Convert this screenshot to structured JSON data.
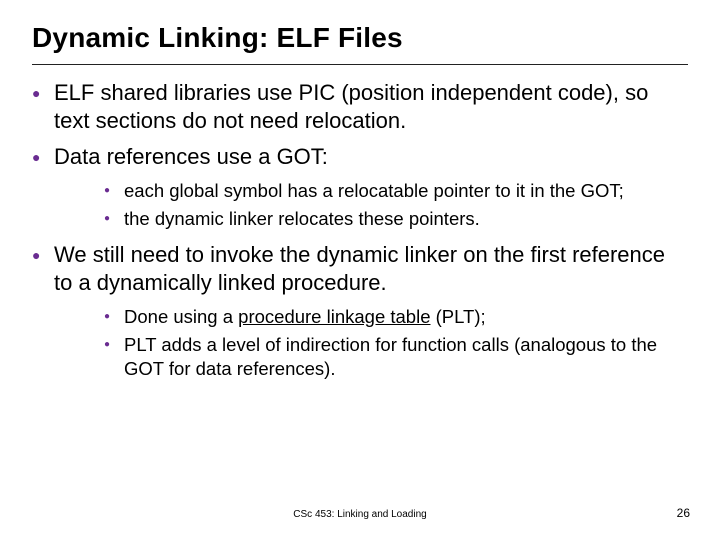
{
  "title": "Dynamic Linking: ELF Files",
  "bullets": {
    "b1": "ELF shared libraries use PIC (position independent code), so text sections do not need relocation.",
    "b2": "Data references use a GOT:",
    "b2sub": {
      "s1": "each global symbol has a relocatable pointer to it in the GOT;",
      "s2": "the dynamic linker relocates these pointers."
    },
    "b3": "We still need to invoke the dynamic linker on the first reference to a dynamically linked procedure.",
    "b3sub": {
      "s1_pre": "Done using a ",
      "s1_u": "procedure linkage table",
      "s1_post": " (PLT);",
      "s2": "PLT adds a level of indirection for function calls (analogous to the GOT for data references)."
    }
  },
  "footer": {
    "center": "CSc 453: Linking and Loading",
    "page": "26"
  }
}
